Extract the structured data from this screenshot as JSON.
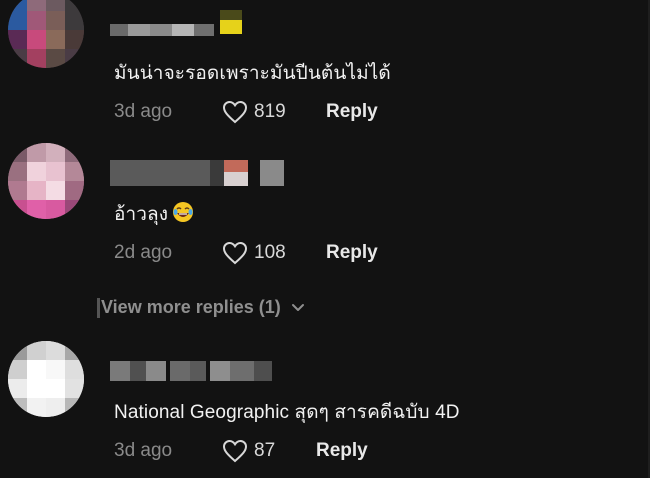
{
  "comments": [
    {
      "text": "มันน่าจะรอดเพราะมันปีนต้นไม่ได้",
      "time": "3d ago",
      "likes": "819",
      "reply": "Reply",
      "avatar_colors": [
        "#1d6fbf",
        "#c44a7a",
        "#8a6a5a",
        "#5a4a6a"
      ]
    },
    {
      "text": "อ้าวลุง",
      "emoji": "laughing-tears",
      "time": "2d ago",
      "likes": "108",
      "reply": "Reply",
      "avatar_colors": [
        "#c9a0b0",
        "#e6b7c7",
        "#b06a8a",
        "#f0d0dc"
      ]
    },
    {
      "text": "National Geographic สุดๆ สารคดีฉบับ 4D",
      "time": "3d ago",
      "likes": "87",
      "reply": "Reply",
      "avatar_colors": [
        "#e0e0e0",
        "#f5f5f5",
        "#cfcfcf",
        "#ffffff"
      ]
    }
  ],
  "view_more": {
    "label": "View more replies (1)"
  },
  "colors": {
    "background": "#121212",
    "muted_text": "#8a8a8a",
    "primary_text": "#f2f2f2"
  }
}
